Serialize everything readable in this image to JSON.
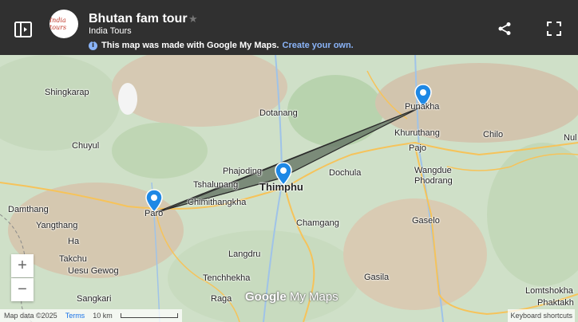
{
  "header": {
    "logo_text": "India tours",
    "title": "Bhutan fam tour",
    "owner": "India Tours",
    "info_text": "This map was made with Google My Maps.",
    "info_link": "Create your own."
  },
  "map_labels": {
    "shingkarap": "Shingkarap",
    "dotanang": "Dotanang",
    "punakha": "Punakha",
    "khuruthang": "Khuruthang",
    "chilo": "Chilo",
    "pajo": "Pajo",
    "nul": "Nul",
    "chuyul": "Chuyul",
    "phajoding": "Phajoding",
    "tshalunang": "Tshalunang",
    "thimphu": "Thimphu",
    "dochula": "Dochula",
    "wangdue": "Wangdue Phodrang",
    "chimithangkha": "Chimithangkha",
    "paro": "Paro",
    "damthang": "Damthang",
    "yangthang": "Yangthang",
    "chamgang": "Chamgang",
    "gaselo": "Gaselo",
    "ha": "Ha",
    "takchu": "Takchu",
    "uesu_gewog": "Uesu Gewog",
    "langdru": "Langdru",
    "tenchhekha": "Tenchhekha",
    "gasila": "Gasila",
    "sangkari": "Sangkari",
    "raga": "Raga",
    "lomtshokha": "Lomtshokha",
    "phaktakha": "Phaktakh"
  },
  "controls": {
    "zoom_in": "+",
    "zoom_out": "−"
  },
  "brand": {
    "google": "Google",
    "mymaps": "My Maps"
  },
  "footer": {
    "map_data": "Map data ©2025",
    "terms": "Terms",
    "scale": "10 km",
    "shortcuts": "Keyboard shortcuts"
  },
  "colors": {
    "header_bg": "#303030",
    "link": "#8ab4f8",
    "pin": "#1e88e5",
    "route_fill": "#5f6f5f"
  }
}
